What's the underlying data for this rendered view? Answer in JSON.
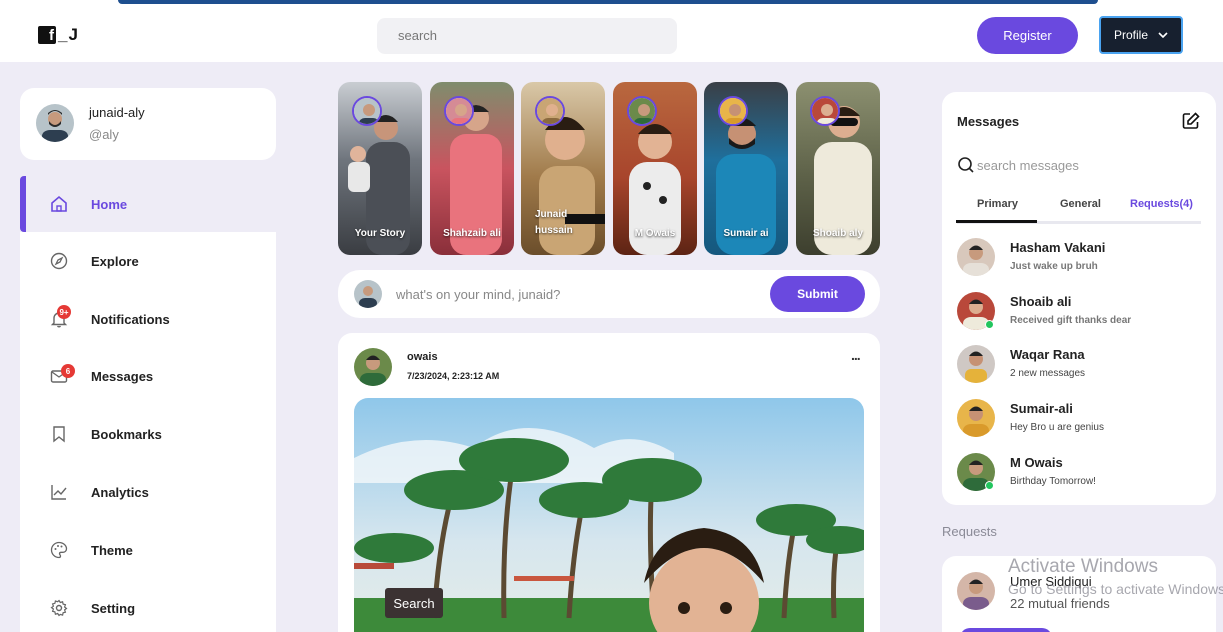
{
  "header": {
    "logo_text": "_J",
    "search_placeholder": "search",
    "register_label": "Register",
    "profile_label": "Profile"
  },
  "user": {
    "name": "junaid-aly",
    "handle": "@aly"
  },
  "sidebar": {
    "items": [
      {
        "label": "Home",
        "icon": "home-icon",
        "active": true
      },
      {
        "label": "Explore",
        "icon": "compass-icon"
      },
      {
        "label": "Notifications",
        "icon": "bell-icon",
        "badge": "9+"
      },
      {
        "label": "Messages",
        "icon": "mail-icon",
        "badge": "6"
      },
      {
        "label": "Bookmarks",
        "icon": "bookmark-icon"
      },
      {
        "label": "Analytics",
        "icon": "chart-icon"
      },
      {
        "label": "Theme",
        "icon": "palette-icon"
      },
      {
        "label": "Setting",
        "icon": "gear-icon"
      }
    ]
  },
  "stories": [
    {
      "name": "Your Story",
      "bg": "#7a7f86"
    },
    {
      "name": "Shahzaib ali",
      "bg": "#c9545f"
    },
    {
      "name": "Junaid hussain",
      "bg": "#8b6a3e"
    },
    {
      "name": "M Owais",
      "bg": "#a8452c"
    },
    {
      "name": "Sumair ai",
      "bg": "#1f6f9c"
    },
    {
      "name": "Shoaib aly",
      "bg": "#5d6148"
    }
  ],
  "create_post": {
    "placeholder": "what's on  your mind, junaid?",
    "submit_label": "Submit"
  },
  "feed": {
    "post": {
      "author": "owais",
      "time": "7/23/2024, 2:23:12 AM",
      "more": "..."
    },
    "tooltip": "Search"
  },
  "messages": {
    "title": "Messages",
    "search_placeholder": "search messages",
    "tabs": [
      "Primary",
      "General",
      "Requests(4)"
    ],
    "items": [
      {
        "name": "Hasham Vakani",
        "text": "Just wake up bruh",
        "bold": true,
        "online": false
      },
      {
        "name": "Shoaib ali",
        "text": "Received gift thanks dear",
        "bold": true,
        "online": true
      },
      {
        "name": "Waqar Rana",
        "text": "2 new messages",
        "bold": false,
        "online": false
      },
      {
        "name": "Sumair-ali",
        "text": "Hey Bro u are genius",
        "bold": false,
        "online": false
      },
      {
        "name": "M Owais",
        "text": "Birthday Tomorrow!",
        "bold": false,
        "online": true
      }
    ]
  },
  "requests": {
    "label": "Requests",
    "item": {
      "name": "Umer Siddiqui",
      "mutual": "22 mutual friends"
    }
  },
  "watermark": {
    "title": "Activate Windows",
    "subtitle": "Go to Settings to activate Windows."
  },
  "colors": {
    "accent": "#6a49df",
    "background": "#eeecf6",
    "profile_button": "#17202f",
    "badge": "#e53935",
    "online": "#22c55e"
  }
}
